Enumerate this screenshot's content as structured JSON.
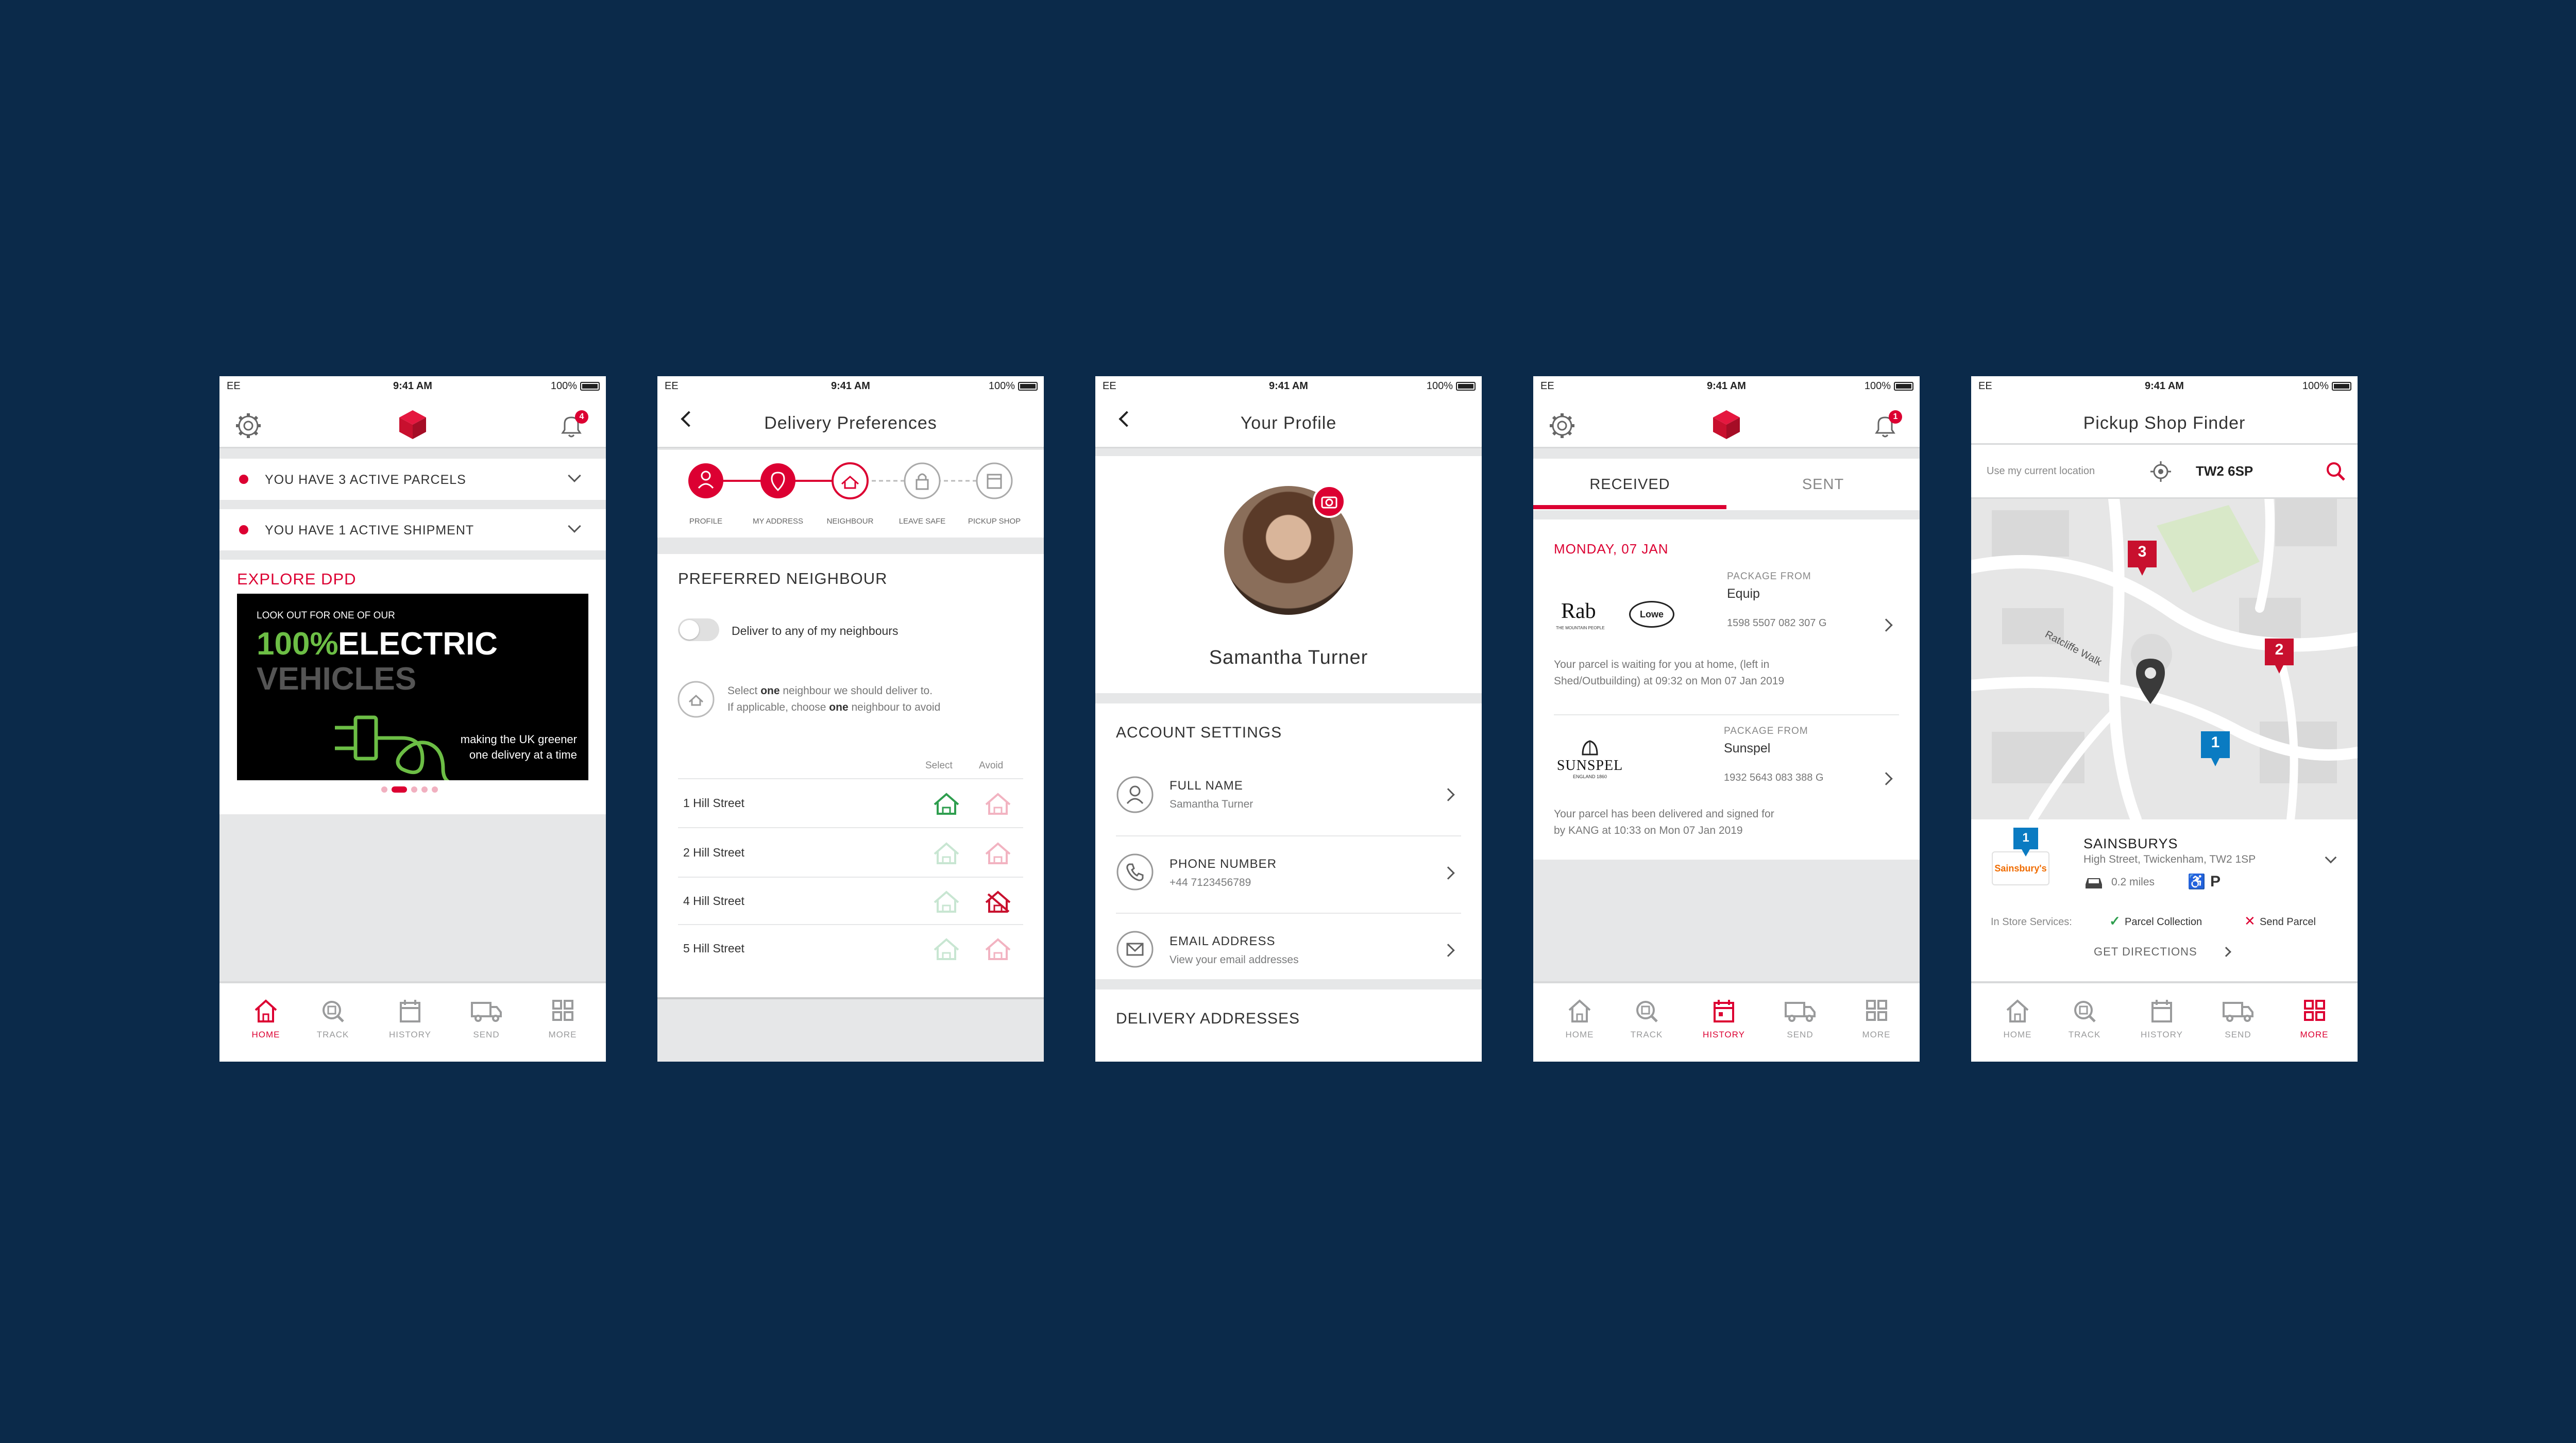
{
  "status_bar": {
    "carrier": "EE",
    "time": "9:41 AM",
    "battery": "100%"
  },
  "screen1": {
    "notif_count": "4",
    "parcels_text": "YOU HAVE 3 ACTIVE PARCELS",
    "shipment_text": "YOU HAVE 1 ACTIVE SHIPMENT",
    "explore_label": "EXPLORE DPD",
    "banner": {
      "kicker": "LOOK OUT FOR ONE OF OUR",
      "highlight": "100%",
      "line1": "ELECTRIC",
      "line2": "VEHICLES",
      "tag1": "making the UK greener",
      "tag2": "one delivery at a time"
    }
  },
  "screen2": {
    "title": "Delivery Preferences",
    "steps": [
      "PROFILE",
      "MY ADDRESS",
      "NEIGHBOUR",
      "LEAVE SAFE",
      "PICKUP SHOP"
    ],
    "section": "PREFERRED NEIGHBOUR",
    "toggle_label": "Deliver to any of my neighbours",
    "hint_parts": [
      "Select ",
      "one",
      " neighbour we should deliver to.",
      "If applicable, choose ",
      "one",
      " neighbour to avoid"
    ],
    "col_select": "Select",
    "col_avoid": "Avoid",
    "neighbours": [
      "1 Hill Street",
      "2 Hill Street",
      "4 Hill Street",
      "5 Hill Street"
    ]
  },
  "screen3": {
    "title": "Your Profile",
    "name": "Samantha Turner",
    "section": "ACCOUNT SETTINGS",
    "fields": [
      {
        "label": "FULL NAME",
        "value": "Samantha Turner"
      },
      {
        "label": "PHONE NUMBER",
        "value": "+44 7123456789"
      },
      {
        "label": "EMAIL ADDRESS",
        "value": "View your email addresses"
      }
    ],
    "addresses": "DELIVERY ADDRESSES"
  },
  "screen4": {
    "notif_count": "1",
    "tab_received": "RECEIVED",
    "tab_sent": "SENT",
    "date": "MONDAY, 07 JAN",
    "package_from": "PACKAGE FROM",
    "items": [
      {
        "sender": "Equip",
        "tracking": "1598 5507 082 307 G",
        "msg1": "Your parcel is waiting for you at home, (left in",
        "msg2": "Shed/Outbuilding) at 09:32 on Mon 07 Jan 2019",
        "logo1": "Rab",
        "logo1sub": "THE MOUNTAIN PEOPLE",
        "logo2": "Lowe alpine"
      },
      {
        "sender": "Sunspel",
        "tracking": "1932 5643 083 388 G",
        "msg1": "Your parcel has been delivered and signed for",
        "msg2": "by KANG at 10:33 on Mon 07 Jan 2019",
        "logo1": "SUNSPEL",
        "logo1sub": "ENGLAND 1860"
      }
    ]
  },
  "screen5": {
    "title": "Pickup Shop Finder",
    "location_hint": "Use my current location",
    "postcode": "TW2 6SP",
    "street": "Ratcliffe Walk",
    "pins": [
      "1",
      "2",
      "3"
    ],
    "shop": {
      "num": "1",
      "name": "SAINSBURYS",
      "address": "High Street, Twickenham, TW2 1SP",
      "logo": "Sainsbury's",
      "distance": "0.2 miles",
      "parking": "P",
      "services_label": "In Store Services:",
      "service1": "Parcel Collection",
      "service2": "Send Parcel",
      "directions": "GET DIRECTIONS"
    }
  },
  "nav": [
    "HOME",
    "TRACK",
    "HISTORY",
    "SEND",
    "MORE"
  ],
  "colors": {
    "brand": "#dc0032",
    "background": "#0b2a4a",
    "green": "#6cbe45",
    "blue": "#0a7bc2"
  }
}
